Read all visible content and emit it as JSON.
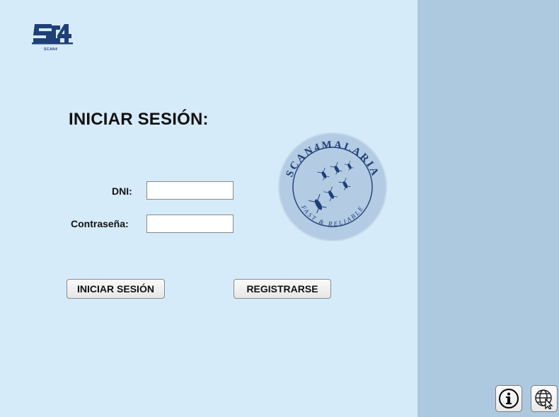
{
  "branding": {
    "top_logo_text": "SC4",
    "top_logo_caption": "SCAN4",
    "circle_logo_arc_top": "SCAN4MALARIA",
    "circle_logo_arc_bottom": "FAST & RELIABLE"
  },
  "login": {
    "title": "INICIAR SESIÓN:",
    "dni_label": "DNI:",
    "dni_value": "",
    "password_label": "Contraseña:",
    "password_value": "",
    "login_button": "INICIAR SESIÓN",
    "register_button": "REGISTRARSE"
  },
  "toolbar": {
    "info_icon": "info-icon",
    "language_icon": "globe-cursor-icon"
  },
  "colors": {
    "main_background": "#d6ebfa",
    "side_panel": "#adc9e0",
    "brand_navy": "#1f3f78",
    "logo_circle_fill": "#b3cbe3"
  }
}
